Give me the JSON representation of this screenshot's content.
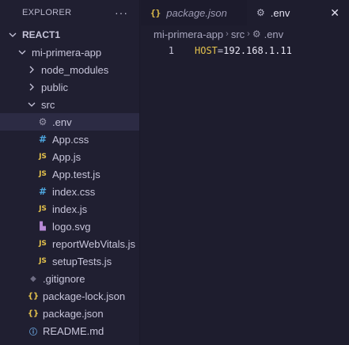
{
  "sidebar": {
    "title": "EXPLORER",
    "more_icon": "ellipsis-icon",
    "tree": [
      {
        "label": "REACT1",
        "type": "root",
        "expanded": true,
        "depth": 0
      },
      {
        "label": "mi-primera-app",
        "type": "folder",
        "expanded": true,
        "depth": 1
      },
      {
        "label": "node_modules",
        "type": "folder",
        "expanded": false,
        "depth": 2
      },
      {
        "label": "public",
        "type": "folder",
        "expanded": false,
        "depth": 2
      },
      {
        "label": "src",
        "type": "folder",
        "expanded": true,
        "depth": 2
      },
      {
        "label": ".env",
        "type": "env",
        "depth": 3,
        "selected": true
      },
      {
        "label": "App.css",
        "type": "css",
        "depth": 3
      },
      {
        "label": "App.js",
        "type": "js",
        "depth": 3
      },
      {
        "label": "App.test.js",
        "type": "js",
        "depth": 3
      },
      {
        "label": "index.css",
        "type": "css",
        "depth": 3
      },
      {
        "label": "index.js",
        "type": "js",
        "depth": 3
      },
      {
        "label": "logo.svg",
        "type": "svg",
        "depth": 3
      },
      {
        "label": "reportWebVitals.js",
        "type": "js",
        "depth": 3
      },
      {
        "label": "setupTests.js",
        "type": "js",
        "depth": 3
      },
      {
        "label": ".gitignore",
        "type": "git",
        "depth": 2
      },
      {
        "label": "package-lock.json",
        "type": "json",
        "depth": 2
      },
      {
        "label": "package.json",
        "type": "json",
        "depth": 2
      },
      {
        "label": "README.md",
        "type": "md",
        "depth": 2
      }
    ]
  },
  "tabs": [
    {
      "label": "package.json",
      "icon": "json-icon",
      "active": false
    },
    {
      "label": ".env",
      "icon": "gear-icon",
      "active": true
    }
  ],
  "breadcrumb": {
    "parts": [
      "mi-primera-app",
      "src",
      ".env"
    ]
  },
  "code": {
    "lines": [
      {
        "number": "1",
        "key": "HOST",
        "eq": "=",
        "value": "192.168.1.11"
      }
    ]
  },
  "colors": {
    "accent_yellow": "#e4c24c",
    "css_blue": "#4ea7e0",
    "background": "#1e1d2e"
  }
}
